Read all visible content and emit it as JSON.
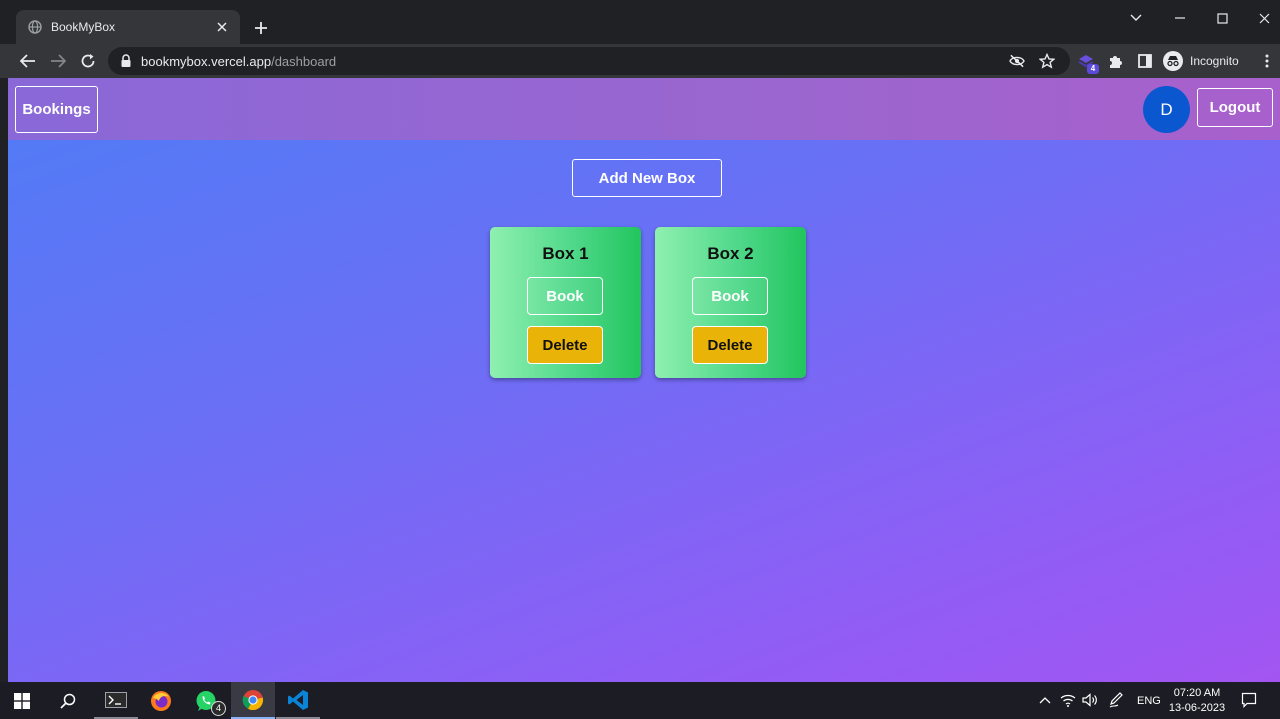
{
  "browser": {
    "tab_title": "BookMyBox",
    "url_host": "bookmybox.vercel.app",
    "url_path": "/dashboard",
    "profile_label": "Incognito",
    "extension_badge": "4"
  },
  "navbar": {
    "bookings_label": "Bookings",
    "avatar_initial": "D",
    "logout_label": "Logout"
  },
  "main": {
    "add_label": "Add New Box",
    "boxes": [
      {
        "title": "Box 1",
        "book_label": "Book",
        "delete_label": "Delete"
      },
      {
        "title": "Box 2",
        "book_label": "Book",
        "delete_label": "Delete"
      }
    ]
  },
  "taskbar": {
    "whatsapp_badge": "4",
    "language": "ENG",
    "time": "07:20 AM",
    "date": "13-06-2023"
  },
  "colors": {
    "avatar": "#0b57d0",
    "delete_button": "#eab308",
    "card_green": "#22c55e"
  }
}
